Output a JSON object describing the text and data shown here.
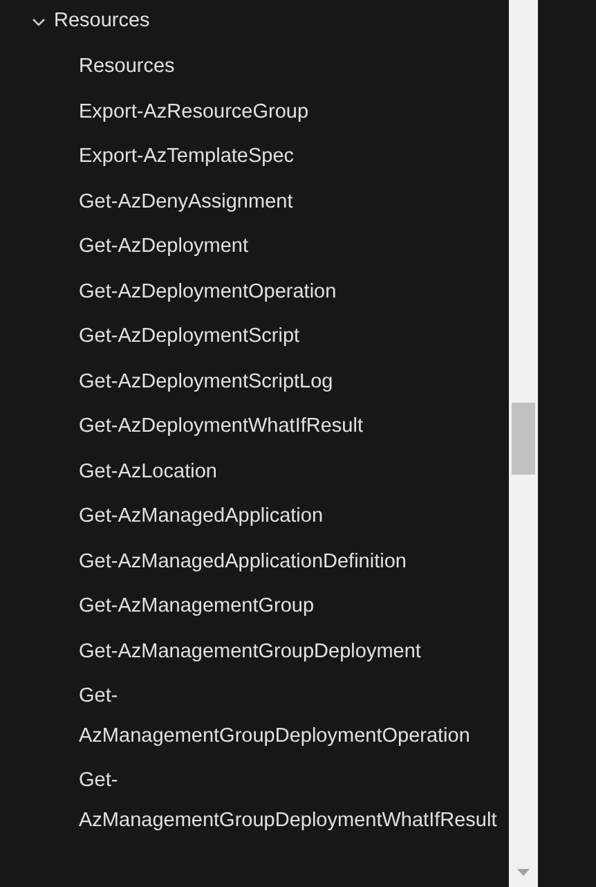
{
  "tree": {
    "label": "Resources",
    "expanded": true,
    "children": [
      {
        "label": "Resources"
      },
      {
        "label": "Export-AzResourceGroup"
      },
      {
        "label": "Export-AzTemplateSpec"
      },
      {
        "label": "Get-AzDenyAssignment"
      },
      {
        "label": "Get-AzDeployment"
      },
      {
        "label": "Get-AzDeploymentOperation"
      },
      {
        "label": "Get-AzDeploymentScript"
      },
      {
        "label": "Get-AzDeploymentScriptLog"
      },
      {
        "label": "Get-AzDeploymentWhatIfResult"
      },
      {
        "label": "Get-AzLocation"
      },
      {
        "label": "Get-AzManagedApplication"
      },
      {
        "label": "Get-AzManagedApplicationDefinition"
      },
      {
        "label": "Get-AzManagementGroup"
      },
      {
        "label": "Get-AzManagementGroupDeployment"
      },
      {
        "label": "Get-AzManagementGroupDeploymentOperation"
      },
      {
        "label": "Get-AzManagementGroupDeploymentWhatIfResult"
      }
    ]
  }
}
